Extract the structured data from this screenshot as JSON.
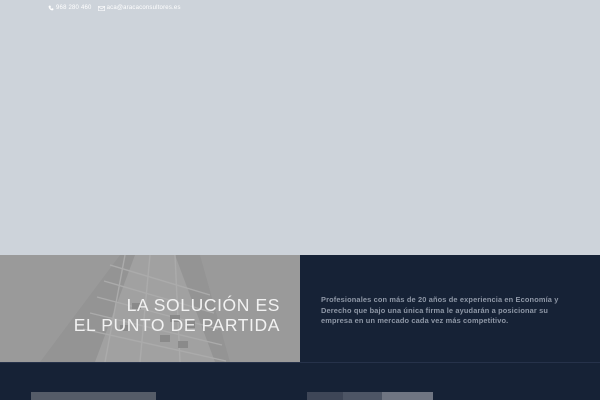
{
  "topbar": {
    "phone": "968 280 460",
    "email": "aca@aracaconsultores.es",
    "phone_icon": "phone-icon",
    "email_icon": "envelope-icon"
  },
  "promo": {
    "tagline_line1": "LA SOLUCIÓN ES",
    "tagline_line2": "EL PUNTO DE PARTIDA",
    "description": "Profesionales con más de 20 años de experiencia en Economía y Derecho que bajo una única firma le ayudarán a posicionar su empresa en un mercado cada vez más competitivo."
  },
  "colors": {
    "hero_bg": "#cdd3da",
    "navy": "#162236",
    "promo_text": "#8e97a6",
    "image_gray": "#9b9b9b"
  }
}
